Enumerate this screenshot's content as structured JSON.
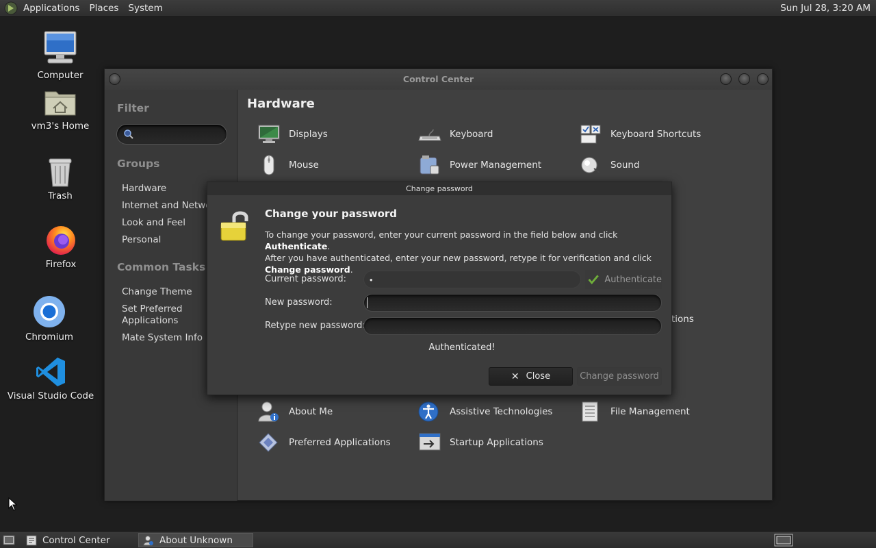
{
  "top_panel": {
    "menus": [
      "Applications",
      "Places",
      "System"
    ],
    "clock": "Sun Jul 28,  3:20 AM"
  },
  "desktop": {
    "icons": [
      {
        "label": "Computer",
        "icon": "computer-icon"
      },
      {
        "label": "vm3's Home",
        "icon": "home-folder-icon"
      },
      {
        "label": "Trash",
        "icon": "trash-icon"
      },
      {
        "label": "Firefox",
        "icon": "firefox-icon"
      },
      {
        "label": "Chromium",
        "icon": "chromium-icon"
      },
      {
        "label": "Visual Studio Code",
        "icon": "vscode-icon"
      }
    ]
  },
  "control_center": {
    "title": "Control Center",
    "sidebar": {
      "filter_heading": "Filter",
      "filter_value": "",
      "groups_heading": "Groups",
      "groups": [
        "Hardware",
        "Internet and Network",
        "Look and Feel",
        "Personal"
      ],
      "tasks_heading": "Common Tasks",
      "tasks": [
        "Change Theme",
        "Set Preferred\nApplications",
        "Mate System Info"
      ]
    },
    "section_title": "Hardware",
    "hardware_items": [
      "Displays",
      "Keyboard",
      "Keyboard Shortcuts",
      "Mouse",
      "Power Management",
      "Sound"
    ],
    "partial_item": "tions",
    "personal_items": [
      "About Me",
      "Assistive Technologies",
      "File Management",
      "Preferred Applications",
      "Startup Applications"
    ]
  },
  "dialog": {
    "title": "Change password",
    "heading": "Change your password",
    "description_parts": {
      "p1": "To change your password, enter your current password in the field below and click ",
      "b1": "Authenticate",
      "p2": ".\nAfter you have authenticated, enter your new password, retype it for verification and click ",
      "b2": "Change password",
      "p3": "."
    },
    "labels": {
      "current": "Current password:",
      "new": "New password:",
      "retype": "Retype new password:"
    },
    "current_password_value": "•",
    "new_password_value": "",
    "retype_password_value": "",
    "authenticate_label": "Authenticate",
    "status": "Authenticated!",
    "close_label": "Close",
    "change_label": "Change password"
  },
  "bottom_panel": {
    "tasks": [
      "Control Center",
      "About Unknown"
    ]
  }
}
